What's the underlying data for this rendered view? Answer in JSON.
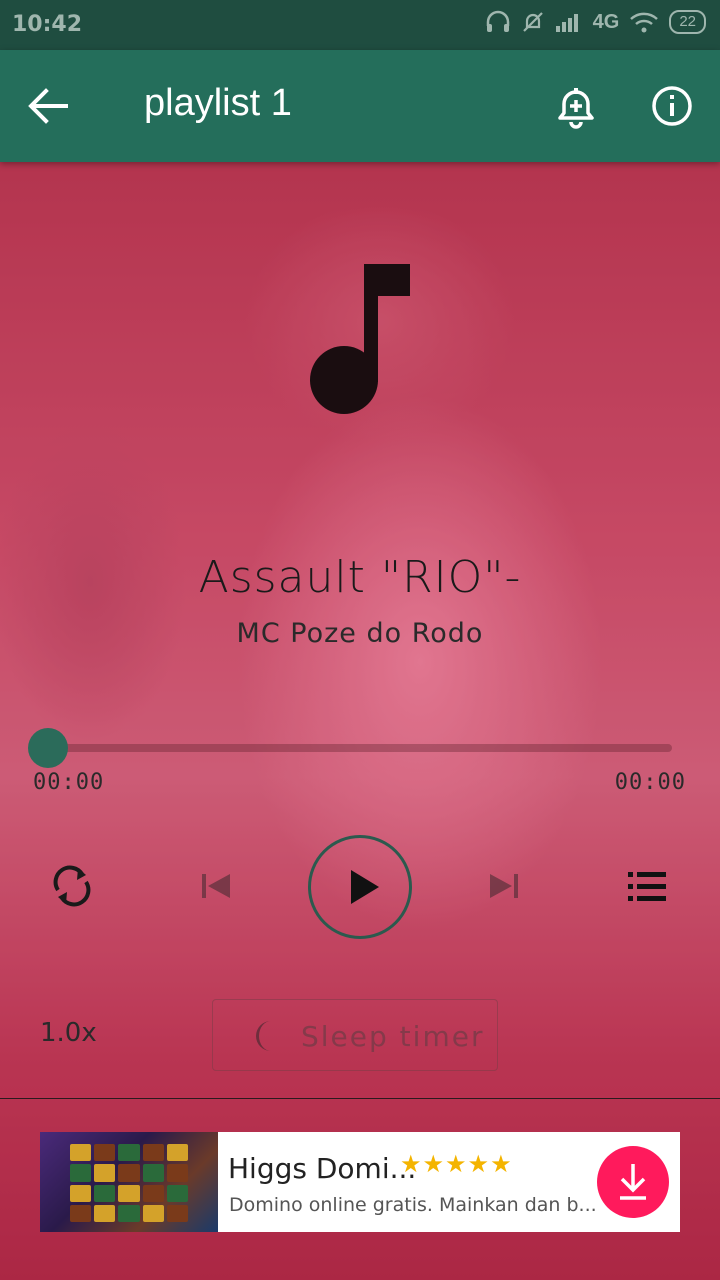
{
  "status_bar": {
    "time": "10:42",
    "network": "4G",
    "battery": "22"
  },
  "app_bar": {
    "title": "playlist 1"
  },
  "track": {
    "title": "Assault \"RIO\"-",
    "artist": "MC Poze do Rodo"
  },
  "progress": {
    "current": "00:00",
    "total": "00:00",
    "fraction": 0
  },
  "controls": {
    "speed": "1.0x",
    "sleep_timer_label": "Sleep timer"
  },
  "ad": {
    "title": "Higgs Domi...",
    "rating": "★★★★★",
    "description": "Domino online gratis. Mainkan dan b..."
  },
  "colors": {
    "status_bar": "#1f4d40",
    "app_bar": "#246e5b",
    "accent": "#2b6b5a",
    "ad_download": "#ff1a5c",
    "stars": "#f4b400"
  },
  "icons": {
    "back": "arrow-left-icon",
    "add_alarm": "bell-plus-icon",
    "info": "info-icon",
    "repeat": "repeat-icon",
    "previous": "skip-previous-icon",
    "play": "play-icon",
    "next": "skip-next-icon",
    "queue": "queue-list-icon",
    "sleep": "moon-icon",
    "download": "download-icon"
  }
}
